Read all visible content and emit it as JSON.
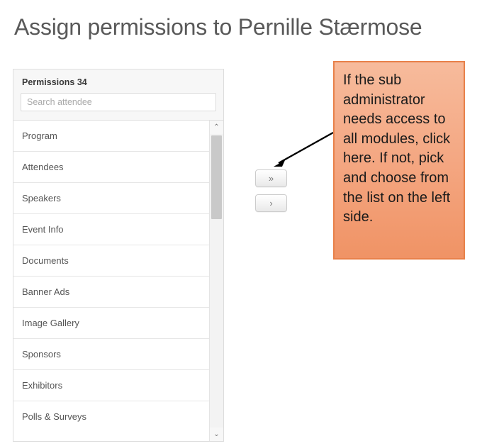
{
  "page": {
    "title": "Assign permissions to Pernille Stærmose"
  },
  "permissions_panel": {
    "header_label": "Permissions 34",
    "count": 34,
    "search": {
      "placeholder": "Search attendee",
      "value": ""
    },
    "items": [
      {
        "label": "Program"
      },
      {
        "label": "Attendees"
      },
      {
        "label": "Speakers"
      },
      {
        "label": "Event Info"
      },
      {
        "label": "Documents"
      },
      {
        "label": "Banner Ads"
      },
      {
        "label": "Image Gallery"
      },
      {
        "label": "Sponsors"
      },
      {
        "label": "Exhibitors"
      },
      {
        "label": "Polls & Surveys"
      }
    ],
    "scrollbar": {
      "up_arrow": "⌃",
      "down_arrow": "⌄"
    }
  },
  "transfer_buttons": {
    "move_all_label": "»",
    "move_selected_label": "›"
  },
  "callout": {
    "text": "If the sub administrator needs access to all modules, click here. If not, pick and choose from the list on the left side.",
    "border_color": "#e8814a",
    "fill_top_color": "#f7bb9c",
    "fill_bottom_color": "#f09365"
  },
  "annotation_arrow": {
    "color": "#000000"
  }
}
